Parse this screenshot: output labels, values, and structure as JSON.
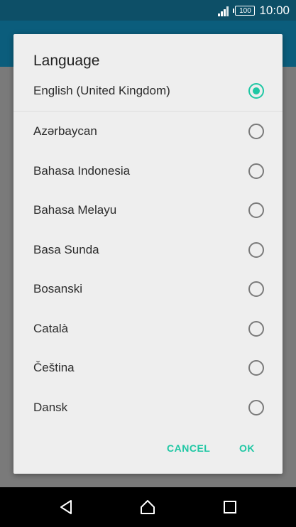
{
  "status_bar": {
    "battery": "100",
    "time": "10:00",
    "icons": [
      "signal-icon",
      "battery-icon"
    ]
  },
  "dialog": {
    "title": "Language",
    "options": [
      {
        "label": "English (United Kingdom)",
        "selected": true
      },
      {
        "label": "Azərbaycan",
        "selected": false
      },
      {
        "label": "Bahasa Indonesia",
        "selected": false
      },
      {
        "label": "Bahasa Melayu",
        "selected": false
      },
      {
        "label": "Basa Sunda",
        "selected": false
      },
      {
        "label": "Bosanski",
        "selected": false
      },
      {
        "label": "Català",
        "selected": false
      },
      {
        "label": "Čeština",
        "selected": false
      },
      {
        "label": "Dansk",
        "selected": false
      }
    ],
    "cancel_label": "CANCEL",
    "ok_label": "OK",
    "accent_color": "#1fc7a4"
  },
  "nav_bar": {
    "icons": [
      "back-icon",
      "home-icon",
      "recents-icon"
    ]
  }
}
